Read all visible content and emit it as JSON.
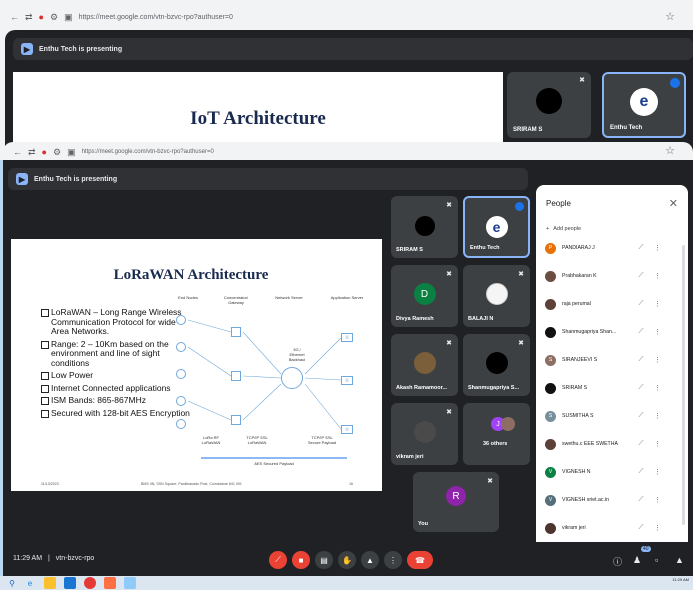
{
  "background_window": {
    "url": "https://meet.google.com/vtn-bzvc-rpo?authuser=0",
    "presenting": "Enthu Tech is presenting",
    "slide_title": "IoT Architecture",
    "tiles": [
      {
        "name": "SRIRAM S"
      },
      {
        "name": "Enthu Tech"
      }
    ]
  },
  "window": {
    "url": "https://meet.google.com/vtn-bzvc-rpo?authuser=0",
    "presenting": "Enthu Tech is presenting"
  },
  "slide": {
    "title": "LoRaWAN Architecture",
    "bullets": [
      "LoRaWAN – Long Range Wireless Communication Protocol for wide Area Networks.",
      "Range: 2 – 10Km based on the environment and line of sight conditions",
      "Low Power",
      "Internet Connected applications",
      "ISM Bands: 865-867MHz",
      "Secured with 128-bit AES Encryption"
    ],
    "diagram_headers": [
      "End Nodes",
      "Concentrator/ Gateway",
      "Network Server",
      "Application Server"
    ],
    "diagram_bottom_labels": [
      "LoRa RF LoRaWAN",
      "TCP/IP SSL LoRaWAN",
      "TCP/IP SSL Secure Payload"
    ],
    "secure_label": "AES Secured Payload",
    "cloud_label": "3G / Ethernet Backhaul",
    "footer_date": "11/13/2023",
    "footer_center": "BMS IIN, SSN Square, Panikkanadu Post, Coimbatore 641 001",
    "footer_page": "16"
  },
  "tiles": [
    {
      "name": "SRIRAM S",
      "initial": "",
      "color": "#000000"
    },
    {
      "name": "Enthu Tech",
      "initial": "e",
      "color": "#ffffff"
    },
    {
      "name": "Divya Ramesh",
      "initial": "D",
      "color": "#0b8043"
    },
    {
      "name": "BALAJI N",
      "initial": "",
      "color": "#ffffff"
    },
    {
      "name": "Akash Ramamoor...",
      "initial": "",
      "color": "#7b5e3a"
    },
    {
      "name": "Shanmugapriya S...",
      "initial": "",
      "color": "#000000"
    },
    {
      "name": "vikram jeri",
      "initial": "",
      "color": "#4a4a4a"
    },
    {
      "name": "36 others",
      "initial": "J",
      "color": "#a142f4"
    },
    {
      "name": "You",
      "initial": "R",
      "color": "#8e24aa"
    }
  ],
  "people": {
    "title": "People",
    "add_label": "Add people",
    "list": [
      {
        "name": "PANDIARAJ J",
        "initial": "P",
        "color": "#e8710a"
      },
      {
        "name": "Prabhakaran K",
        "initial": "",
        "color": "#6d4c41"
      },
      {
        "name": "raja perumal",
        "initial": "",
        "color": "#5d4037"
      },
      {
        "name": "Shanmugapriya Shan...",
        "initial": "",
        "color": "#111111"
      },
      {
        "name": "SIRANJEEVI S",
        "initial": "S",
        "color": "#8d6e63"
      },
      {
        "name": "SRIRAM S",
        "initial": "",
        "color": "#111111"
      },
      {
        "name": "SUSMITHA S",
        "initial": "S",
        "color": "#78909c"
      },
      {
        "name": "swethu.c EEE SWETHA",
        "initial": "",
        "color": "#5d4037"
      },
      {
        "name": "VIGNESH N",
        "initial": "V",
        "color": "#0b8043"
      },
      {
        "name": "VIGNESH sriet.ac.in",
        "initial": "V",
        "color": "#546e7a"
      },
      {
        "name": "vikram jeri",
        "initial": "",
        "color": "#4e342e"
      }
    ]
  },
  "bottom": {
    "time": "11:29 AM",
    "separator": "|",
    "meeting_code": "vtn-bzvc-rpo",
    "participant_count": "40"
  },
  "taskbar": {
    "clock_time": "11:29 AM"
  }
}
